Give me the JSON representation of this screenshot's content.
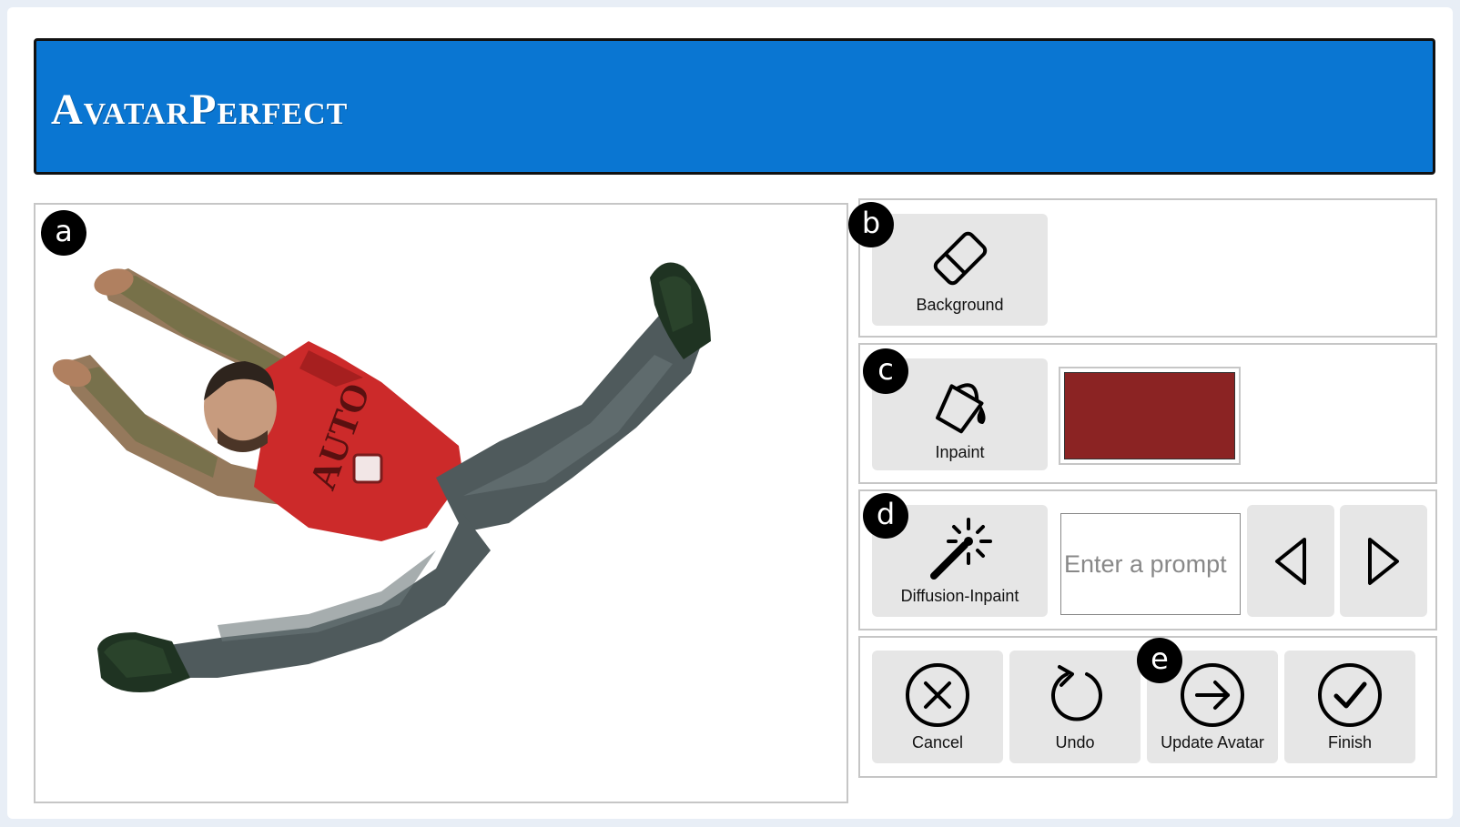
{
  "app": {
    "title": "AvatarPerfect"
  },
  "markers": {
    "a": "a",
    "b": "b",
    "c": "c",
    "d": "d",
    "e": "e"
  },
  "canvas": {
    "description_icon": "avatar-image"
  },
  "background_tool": {
    "label": "Background",
    "icon": "eraser-icon"
  },
  "inpaint_tool": {
    "label": "Inpaint",
    "icon": "paint-bucket-icon",
    "selected_color": "#8b2323"
  },
  "diffusion_tool": {
    "label": "Diffusion-Inpaint",
    "icon": "magic-wand-icon",
    "prompt_placeholder": "Enter a prompt",
    "prompt_value": ""
  },
  "actions": {
    "cancel": "Cancel",
    "undo": "Undo",
    "update": "Update Avatar",
    "finish": "Finish"
  },
  "colors": {
    "header": "#0a76d2",
    "button_bg": "#e6e6e6",
    "panel_border": "#c6c6c6"
  }
}
